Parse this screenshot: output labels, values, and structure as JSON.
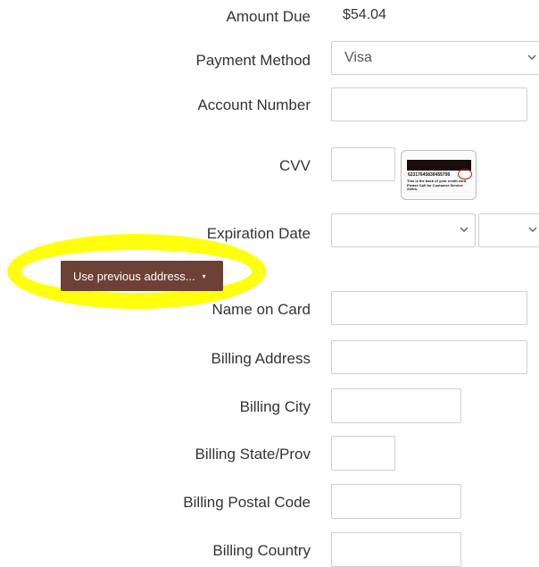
{
  "amount_due": {
    "label": "Amount Due",
    "value": "$54.04"
  },
  "payment_method": {
    "label": "Payment Method",
    "selected": "Visa"
  },
  "account_number": {
    "label": "Account Number",
    "value": ""
  },
  "cvv": {
    "label": "CVV",
    "value": "",
    "card_image": {
      "number": "62317645839455795",
      "code": "123",
      "note": "This is the back of your credit card. Please Call for Customer Service 24Hrs."
    }
  },
  "expiration_date": {
    "label": "Expiration Date",
    "month": "",
    "year": ""
  },
  "previous_address_button": {
    "label": "Use previous address...",
    "caret": "▾"
  },
  "name_on_card": {
    "label": "Name on Card",
    "value": ""
  },
  "billing_address": {
    "label": "Billing Address",
    "value": ""
  },
  "billing_city": {
    "label": "Billing City",
    "value": ""
  },
  "billing_state": {
    "label": "Billing State/Prov",
    "value": ""
  },
  "billing_postal": {
    "label": "Billing Postal Code",
    "value": ""
  },
  "billing_country": {
    "label": "Billing Country",
    "value": ""
  },
  "colors": {
    "button": "#6e4136",
    "highlight": "#ffff00",
    "border": "#cfcfcf"
  },
  "icons": {
    "select_arrow": "chevron-down-icon"
  }
}
